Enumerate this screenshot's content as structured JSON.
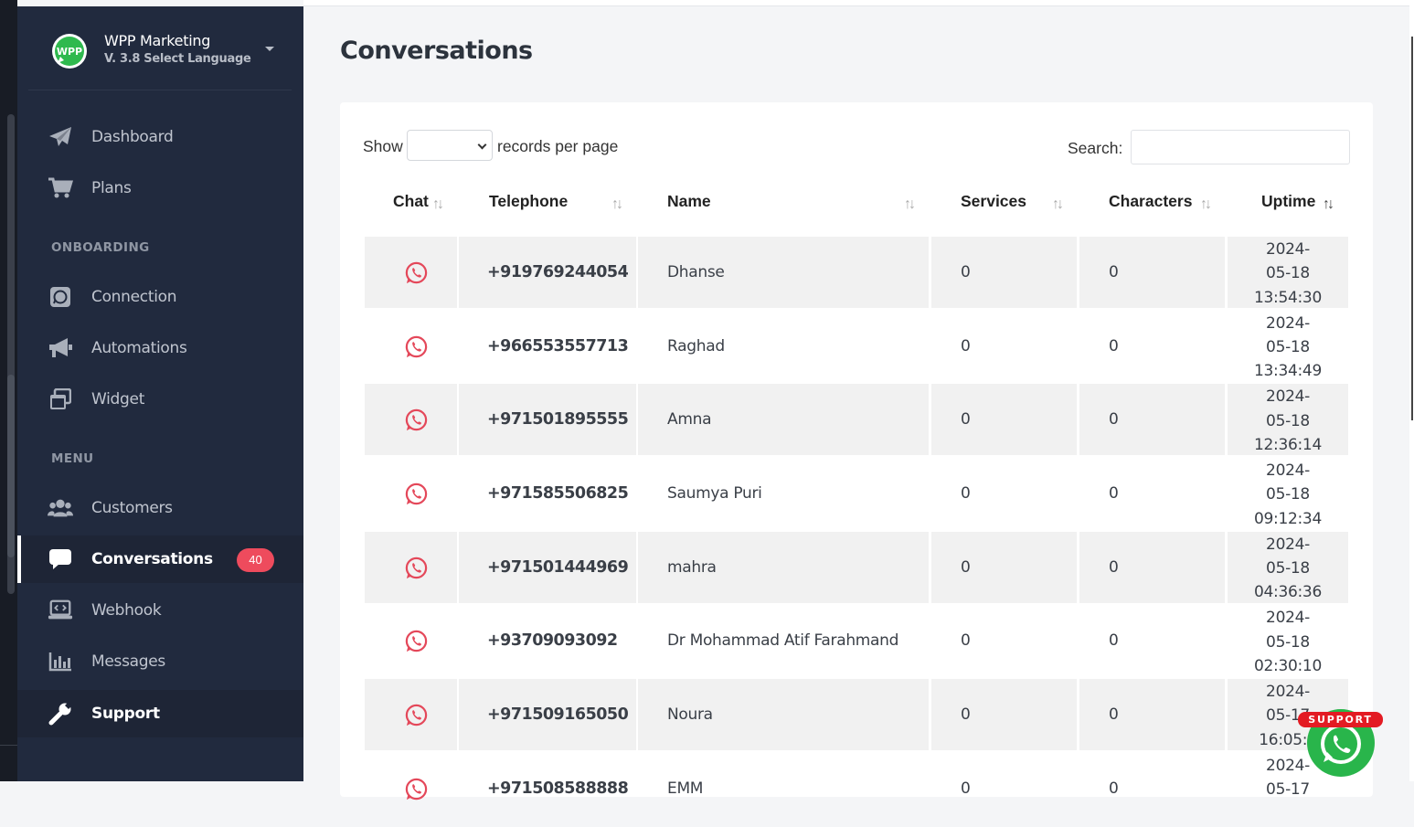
{
  "brand": {
    "title": "WPP Marketing",
    "subtitle": "V. 3.8 Select Language",
    "logo_text": "WPP"
  },
  "sidebar": {
    "items": [
      {
        "label": "Dashboard",
        "icon": "paper-plane-icon"
      },
      {
        "label": "Plans",
        "icon": "shopping-cart-icon"
      },
      {
        "label": "Connection",
        "icon": "whatsapp-square-icon"
      },
      {
        "label": "Automations",
        "icon": "megaphone-icon"
      },
      {
        "label": "Widget",
        "icon": "window-restore-icon"
      },
      {
        "label": "Customers",
        "icon": "users-icon"
      },
      {
        "label": "Conversations",
        "icon": "comment-icon",
        "badge": "40",
        "active": true
      },
      {
        "label": "Webhook",
        "icon": "laptop-code-icon"
      },
      {
        "label": "Messages",
        "icon": "bar-chart-icon"
      },
      {
        "label": "Support",
        "icon": "wrench-icon"
      }
    ],
    "sections": {
      "onboarding": "ONBOARDING",
      "menu": "MENU"
    }
  },
  "page": {
    "title": "Conversations"
  },
  "table_controls": {
    "show_label": "Show",
    "records_label": "records per page",
    "search_label": "Search:",
    "select_value": ""
  },
  "table": {
    "columns": [
      "Chat",
      "Telephone",
      "Name",
      "Services",
      "Characters",
      "Uptime"
    ],
    "rows": [
      {
        "telephone": "+919769244054",
        "name": "Dhanse",
        "services": "0",
        "characters": "0",
        "uptime": [
          "2024-",
          "05-18",
          "13:54:30"
        ]
      },
      {
        "telephone": "+966553557713",
        "name": "Raghad",
        "services": "0",
        "characters": "0",
        "uptime": [
          "2024-",
          "05-18",
          "13:34:49"
        ]
      },
      {
        "telephone": "+971501895555",
        "name": "Amna",
        "services": "0",
        "characters": "0",
        "uptime": [
          "2024-",
          "05-18",
          "12:36:14"
        ]
      },
      {
        "telephone": "+971585506825",
        "name": "Saumya Puri",
        "services": "0",
        "characters": "0",
        "uptime": [
          "2024-",
          "05-18",
          "09:12:34"
        ]
      },
      {
        "telephone": "+971501444969",
        "name": "mahra",
        "services": "0",
        "characters": "0",
        "uptime": [
          "2024-",
          "05-18",
          "04:36:36"
        ]
      },
      {
        "telephone": "+93709093092",
        "name": "Dr Mohammad Atif Farahmand",
        "services": "0",
        "characters": "0",
        "uptime": [
          "2024-",
          "05-18",
          "02:30:10"
        ]
      },
      {
        "telephone": "+971509165050",
        "name": "Noura",
        "services": "0",
        "characters": "0",
        "uptime": [
          "2024-",
          "05-17",
          "16:05:5"
        ]
      },
      {
        "telephone": "+971508588888",
        "name": "EMM",
        "services": "0",
        "characters": "0",
        "uptime": [
          "2024-",
          "05-17",
          ""
        ]
      }
    ]
  },
  "support_widget": {
    "label": "SUPPORT"
  },
  "colors": {
    "sidebar_bg": "#212a3e",
    "badge": "#ee4b5d",
    "whatsapp_red": "#e4485a",
    "whatsapp_green": "#29b54b",
    "support_tag": "#e31b23"
  }
}
